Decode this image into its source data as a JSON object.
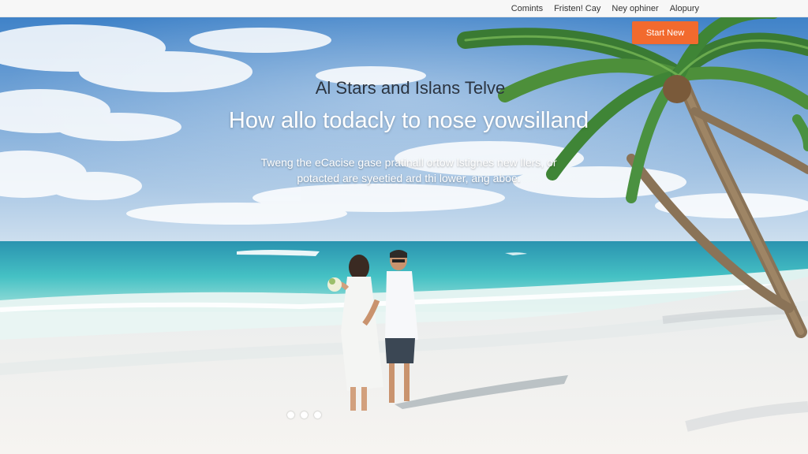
{
  "nav": {
    "items": [
      "Comints",
      "Fristen! Cay",
      "Ney ophiner",
      "Alopury"
    ]
  },
  "hero": {
    "cta_label": "Start New",
    "subtitle": "Al Stars and Islans Telve",
    "headline": "How allo todacly to nose yowsilland",
    "description_line1": "Tweng the eCacise gase pratinall ortow lstignes new llers, or",
    "description_line2": "potacted are syeetied ard thi lower, ang aboe.",
    "slides": 3,
    "active_slide": 1
  },
  "colors": {
    "accent": "#f26a2e",
    "sky": "#5a95cf",
    "sea": "#3fb6bf",
    "sand": "#f1f1ef"
  }
}
